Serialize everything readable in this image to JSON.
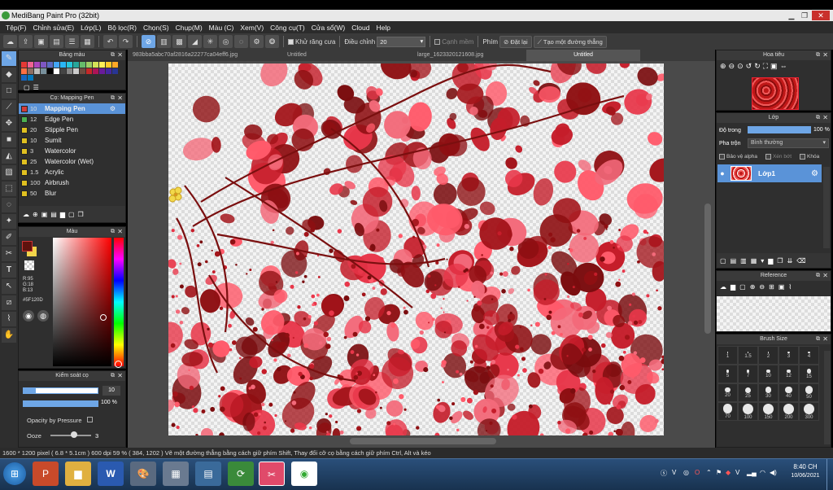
{
  "window": {
    "title": "MediBang Paint Pro (32bit)"
  },
  "menu": [
    "Tệp(F)",
    "Chỉnh sửa(E)",
    "Lớp(L)",
    "Bộ lọc(R)",
    "Chọn(S)",
    "Chụp(M)",
    "Màu (C)",
    "Xem(V)",
    "Công cụ(T)",
    "Cửa sổ(W)",
    "Cloud",
    "Help"
  ],
  "toolbar": {
    "antialias_label": "Khử răng cưa",
    "adjust_label": "Điều chỉnh",
    "adjust_value": "20",
    "soften_label": "Cạnh mềm",
    "key_label": "Phím",
    "reset_label": "Đặt lại",
    "make_line_label": "Tạo một đường thẳng"
  },
  "tabs": [
    "983bba5abc70af2816a22277ca04eff6.jpg",
    "Untitled",
    "large_1623320121608.jpg",
    "Untitled"
  ],
  "palette": {
    "title": "Bảng màu"
  },
  "brushes": {
    "title": "Cọ: Mapping Pen",
    "items": [
      {
        "size": "10",
        "name": "Mapping Pen",
        "color": "#d23c3c"
      },
      {
        "size": "12",
        "name": "Edge Pen",
        "color": "#4caf50"
      },
      {
        "size": "20",
        "name": "Stipple Pen",
        "color": "#e0c020"
      },
      {
        "size": "10",
        "name": "Sumit",
        "color": "#e0c020"
      },
      {
        "size": "3",
        "name": "Watercolor",
        "color": "#e0c020"
      },
      {
        "size": "25",
        "name": "Watercolor (Wet)",
        "color": "#e0c020"
      },
      {
        "size": "1.5",
        "name": "Acrylic",
        "color": "#e0c020"
      },
      {
        "size": "100",
        "name": "Airbrush",
        "color": "#e0c020"
      },
      {
        "size": "50",
        "name": "Blur",
        "color": "#e0c020"
      }
    ]
  },
  "color": {
    "title": "Màu",
    "r": "R:95",
    "g": "G:18",
    "b": "B:13",
    "hex": "#5F120D",
    "primary": "#5F120D",
    "secondary": "#f2d44a"
  },
  "brush_control": {
    "title": "Kiểm soát cọ",
    "size_value": "10",
    "opacity_value": "100 %",
    "pressure_label": "Opacity by Pressure",
    "ooze_label": "Ooze",
    "ooze_value": "3"
  },
  "navigator": {
    "title": "Hoa tiêu"
  },
  "layers": {
    "title": "Lớp",
    "opacity_label": "Độ trong",
    "opacity_value": "100 %",
    "blend_label": "Pha trộn",
    "blend_value": "Bình thường",
    "protect_alpha": "Bảo vệ alpha",
    "clipping": "Xén bớt",
    "lock": "Khóa",
    "layer_name": "Lớp1"
  },
  "reference": {
    "title": "Reference"
  },
  "brush_size": {
    "title": "Brush Size",
    "sizes": [
      "1",
      "1.5",
      "2",
      "3",
      "4",
      "5",
      "7",
      "10",
      "12",
      "15",
      "20",
      "25",
      "30",
      "40",
      "50",
      "70",
      "100",
      "150",
      "200",
      "300"
    ]
  },
  "status": {
    "text": "1600 * 1200 pixel   ( 6.8 * 5.1cm )   600 dpi   59 %   ( 384, 1202 )   Vẽ một đường thẳng bằng cách giữ phím Shift, Thay đổi cỡ cọ bằng cách giữ phím Ctrl, Alt và kéo"
  },
  "taskbar": {
    "time": "8:40 CH",
    "date": "10/06/2021"
  }
}
